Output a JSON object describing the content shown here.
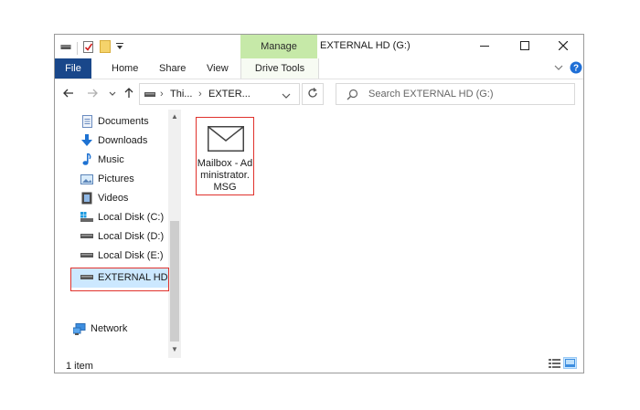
{
  "title_bar": {
    "manage_tab": "Manage",
    "window_title": "EXTERNAL HD (G:)"
  },
  "ribbon": {
    "tabs": [
      "File",
      "Home",
      "Share",
      "View",
      "Drive Tools"
    ]
  },
  "address_bar": {
    "crumbs": [
      "Thi...",
      "EXTER..."
    ],
    "search_placeholder": "Search EXTERNAL HD (G:)"
  },
  "nav_pane": {
    "items": [
      {
        "label": "Documents",
        "icon": "documents-icon"
      },
      {
        "label": "Downloads",
        "icon": "downloads-icon"
      },
      {
        "label": "Music",
        "icon": "music-icon"
      },
      {
        "label": "Pictures",
        "icon": "pictures-icon"
      },
      {
        "label": "Videos",
        "icon": "videos-icon"
      },
      {
        "label": "Local Disk (C:)",
        "icon": "windows-drive-icon"
      },
      {
        "label": "Local Disk (D:)",
        "icon": "drive-icon"
      },
      {
        "label": "Local Disk (E:)",
        "icon": "drive-icon"
      },
      {
        "label": "EXTERNAL HD (C",
        "icon": "drive-icon"
      },
      {
        "label": "Network",
        "icon": "network-icon"
      }
    ]
  },
  "content": {
    "files": [
      {
        "name": "Mailbox - Administrator.MSG",
        "icon": "envelope-icon"
      }
    ]
  },
  "status_bar": {
    "item_count": "1 item"
  },
  "colors": {
    "file_tab": "#19478a",
    "manage_tab": "#c6e9a8",
    "highlight": "#e0322c",
    "selection": "#cce8ff"
  }
}
